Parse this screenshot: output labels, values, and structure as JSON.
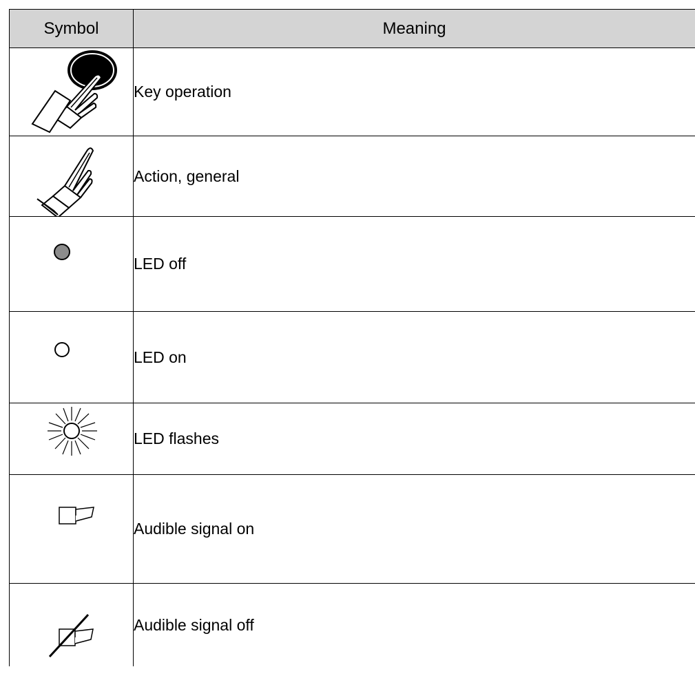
{
  "header": {
    "symbol_label": "Symbol",
    "meaning_label": "Meaning"
  },
  "rows": [
    {
      "icon": "key-operation-icon",
      "meaning": "Key operation"
    },
    {
      "icon": "hand-pointing-icon",
      "meaning": "Action, general"
    },
    {
      "icon": "led-off-icon",
      "meaning": "LED off"
    },
    {
      "icon": "led-on-icon",
      "meaning": "LED on"
    },
    {
      "icon": "led-flashes-icon",
      "meaning": "LED flashes"
    },
    {
      "icon": "horn-icon",
      "meaning": "Audible signal on"
    },
    {
      "icon": "horn-off-icon",
      "meaning": "Audible signal off"
    }
  ],
  "colors": {
    "header_background": "#d4d4d4",
    "led_off_fill": "#8c8c8c",
    "border": "#000000"
  }
}
